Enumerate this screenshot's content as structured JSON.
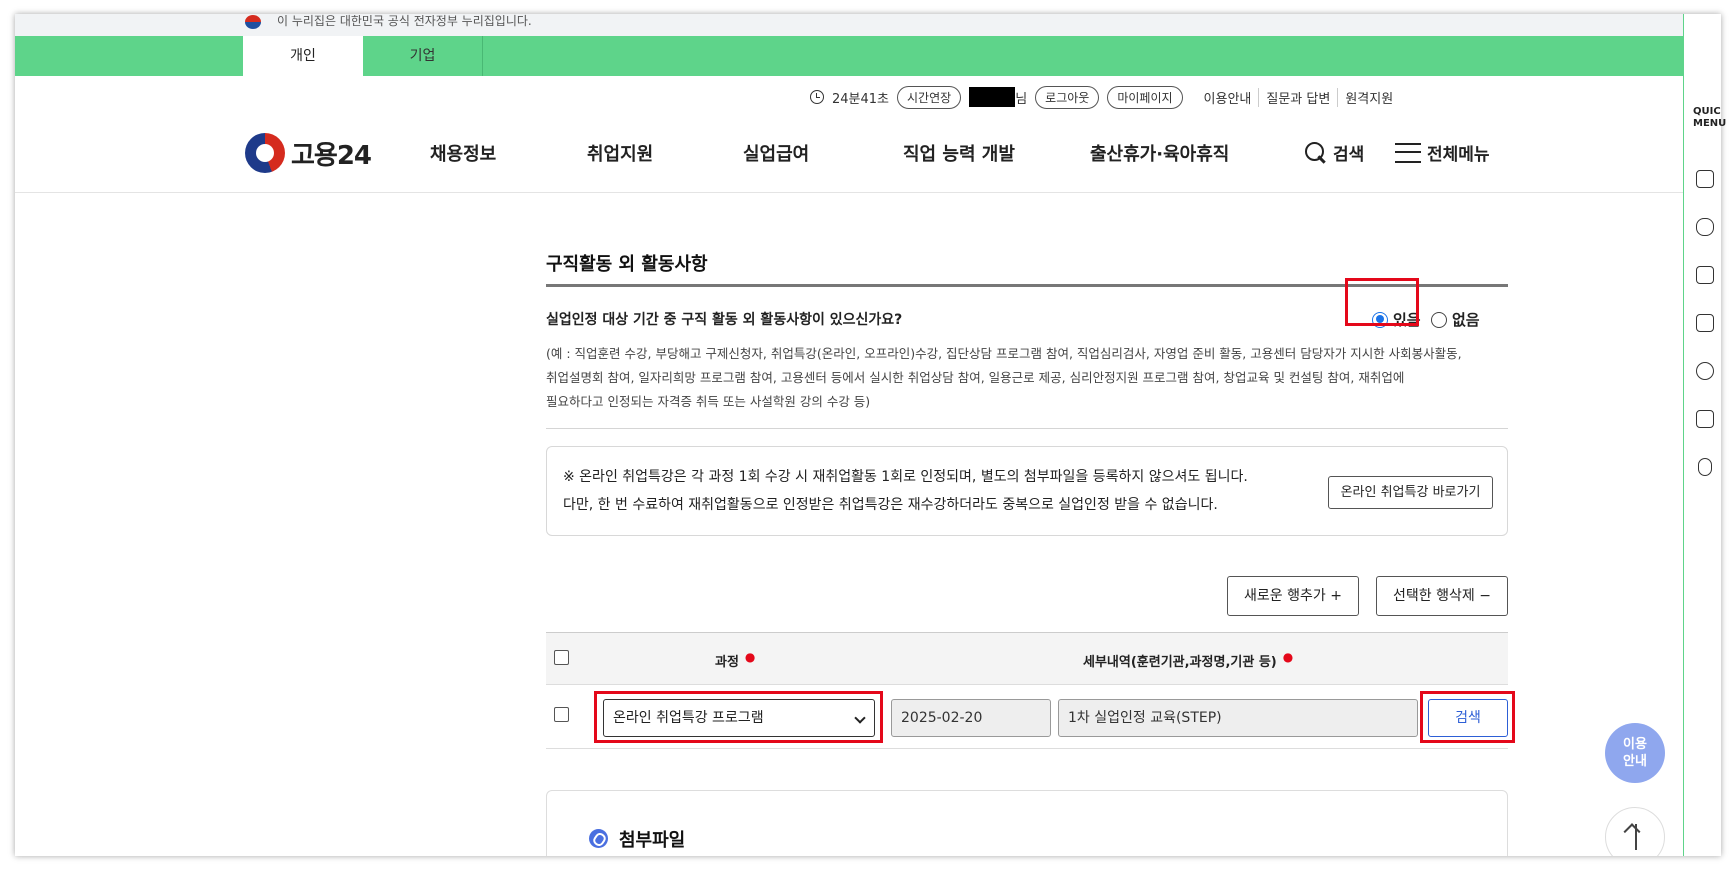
{
  "gov_banner": {
    "text": "이 누리집은 대한민국 공식 전자정부 누리집입니다."
  },
  "tabs": [
    {
      "label": "개인"
    },
    {
      "label": "기업"
    }
  ],
  "utility": {
    "timer": "24분41초",
    "extend_label": "시간연장",
    "user_suffix": "님",
    "logout_label": "로그아웃",
    "mypage_label": "마이페이지",
    "links": [
      "이용안내",
      "질문과 답변",
      "원격지원"
    ]
  },
  "logo": {
    "text": "고용24"
  },
  "nav": {
    "items": [
      "채용정보",
      "취업지원",
      "실업급여",
      "직업 능력 개발",
      "출산휴가·육아휴직"
    ],
    "search_label": "검색",
    "menu_label": "전체메뉴"
  },
  "quick_menu": {
    "label_line1": "QUIC",
    "label_line2": "MENU"
  },
  "section": {
    "title": "구직활동 외 활동사항",
    "question": "실업인정 대상 기간 중 구직 활동 외 활동사항이 있으신가요?",
    "options": [
      {
        "label": "있음",
        "checked": true
      },
      {
        "label": "없음",
        "checked": false
      }
    ],
    "example_lines": [
      "(예 : 직업훈련 수강, 부당해고 구제신청자, 취업특강(온라인, 오프라인)수강, 집단상담 프로그램 참여, 직업심리검사, 자영업 준비 활동, 고용센터 담당자가 지시한 사회봉사활동,",
      "취업설명회 참여, 일자리희망 프로그램 참여, 고용센터 등에서 실시한 취업상담 참여, 일용근로 제공, 심리안정지원 프로그램 참여, 창업교육 및 컨설팅 참여, 재취업에",
      "필요하다고 인정되는 자격증 취득 또는 사설학원 강의 수강 등)"
    ]
  },
  "notice": {
    "line1": "※ 온라인 취업특강은 각 과정 1회 수강 시 재취업활동 1회로 인정되며, 별도의 첨부파일을 등록하지 않으셔도 됩니다.",
    "line2": "다만, 한 번 수료하여 재취업활동으로 인정받은 취업특강은 재수강하더라도 중복으로 실업인정 받을 수 없습니다.",
    "button_label": "온라인 취업특강 바로가기"
  },
  "table_actions": {
    "add_label": "새로운 행추가 +",
    "delete_label": "선택한 행삭제 −"
  },
  "table": {
    "headers": [
      "과정",
      "세부내역(훈련기관,과정명,기관 등)"
    ],
    "rows": [
      {
        "course": "온라인 취업특강 프로그램",
        "date": "2025-02-20",
        "detail": "1차 실업인정 교육(STEP)",
        "search_label": "검색"
      }
    ]
  },
  "attachment": {
    "title": "첨부파일"
  },
  "floating": {
    "guide_line1": "이용",
    "guide_line2": "안내"
  },
  "colors": {
    "brand_green": "#5ed48a",
    "highlight_red": "#e4081a",
    "accent_blue": "#2d5fd6"
  }
}
